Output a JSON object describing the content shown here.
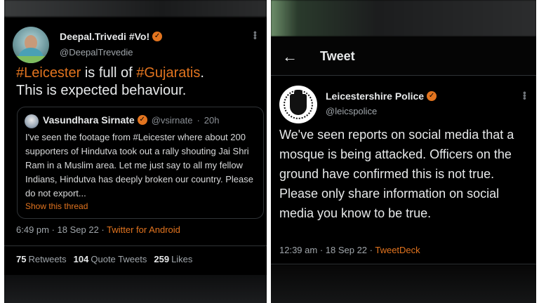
{
  "left_tweet": {
    "author_name": "Deepal.Trivedi #Vo!",
    "author_handle": "@DeepalTrevedie",
    "text_parts": [
      "#Leicester",
      " is full of ",
      "#Gujaratis",
      ".",
      "This is expected behaviour."
    ],
    "quoted": {
      "author_name": "Vasundhara Sirnate",
      "author_handle": "@vsirnate",
      "age": "20h",
      "text": "I've seen the footage from #Leicester where about 200 supporters of Hindutva took out a rally shouting Jai Shri Ram in a Muslim area. Let me just say to all my fellow Indians, Hindutva has deeply broken our country. Please do not export...",
      "show_thread_label": "Show this thread"
    },
    "timestamp": "6:49 pm · 18 Sep 22 · ",
    "source": "Twitter for Android",
    "stats": [
      {
        "count": "75",
        "label": "Retweets"
      },
      {
        "count": "104",
        "label": "Quote Tweets"
      },
      {
        "count": "259",
        "label": "Likes"
      }
    ]
  },
  "right_tweet": {
    "header_title": "Tweet",
    "author_name": "Leicestershire Police",
    "author_handle": "@leicspolice",
    "text": "We've seen reports on social media that a mosque is being attacked. Officers on the ground have confirmed this is not true. Please only share information on social media you know to be true.",
    "timestamp": "12:39 am · 18 Sep 22 · ",
    "source": "TweetDeck"
  },
  "icons": {
    "verified": "verified-badge-icon",
    "more": "more-options-icon",
    "back": "back-arrow-icon"
  },
  "colors": {
    "accent": "#e2741f",
    "background": "#000000",
    "text": "#e7e9ea",
    "muted": "#a0a6ab"
  }
}
